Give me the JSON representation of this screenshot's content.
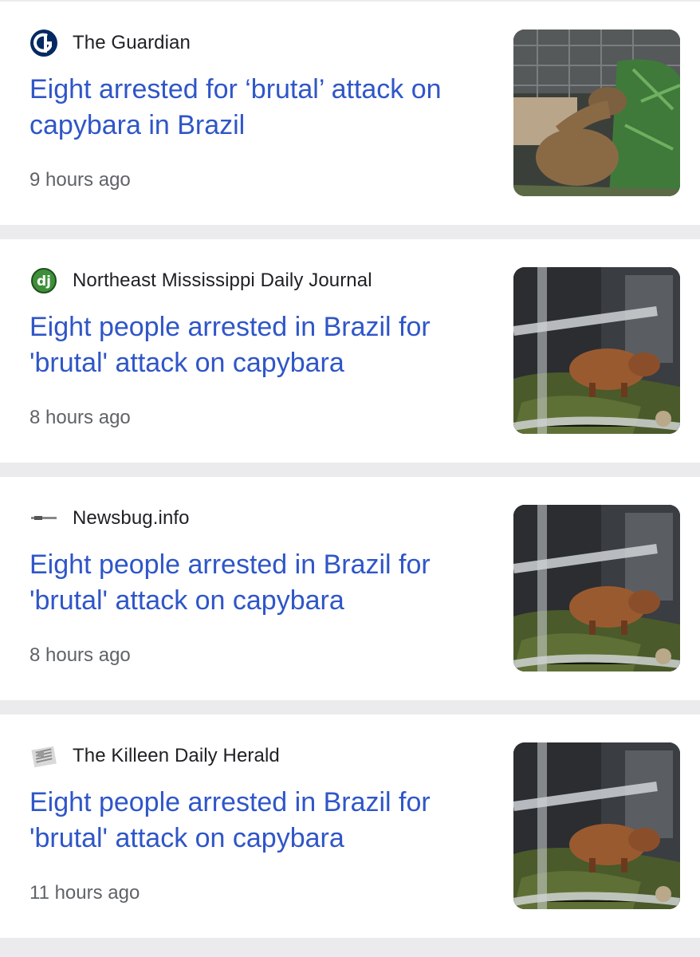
{
  "articles": [
    {
      "source": "The Guardian",
      "source_icon": "guardian-logo-icon",
      "headline": "Eight arrested for ‘brutal’ attack on capybara in Brazil",
      "time": "9 hours ago",
      "thumbnail": "capybara-enclosure-photo"
    },
    {
      "source": "Northeast Mississippi Daily Journal",
      "source_icon": "daily-journal-logo-icon",
      "headline": "Eight people arrested in Brazil for 'brutal' attack on capybara",
      "time": "8 hours ago",
      "thumbnail": "capybara-cage-photo"
    },
    {
      "source": "Newsbug.info",
      "source_icon": "newsbug-logo-icon",
      "headline": "Eight people arrested in Brazil for 'brutal' attack on capybara",
      "time": "8 hours ago",
      "thumbnail": "capybara-cage-photo"
    },
    {
      "source": "The Killeen Daily Herald",
      "source_icon": "killeen-herald-logo-icon",
      "headline": "Eight people arrested in Brazil for 'brutal' attack on capybara",
      "time": "11 hours ago",
      "thumbnail": "capybara-cage-photo"
    }
  ],
  "colors": {
    "headline": "#2f56c8",
    "source": "#202124",
    "time": "#5f6368",
    "separator": "#ebebed"
  }
}
